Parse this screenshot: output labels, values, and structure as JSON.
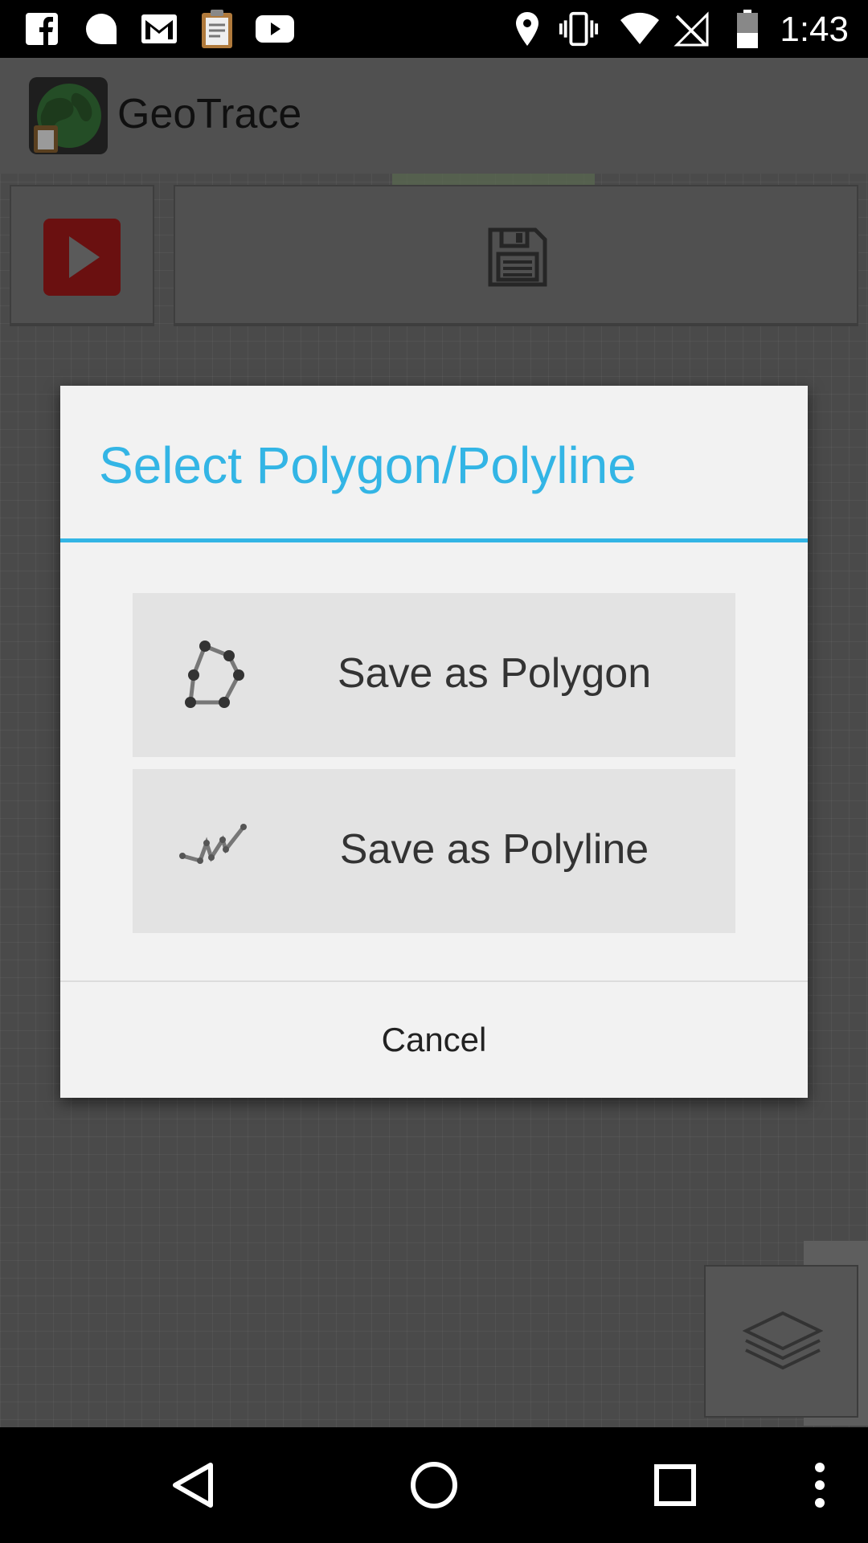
{
  "status_bar": {
    "time": "1:43",
    "icons": [
      "facebook-icon",
      "chat-bubble-icon",
      "gmail-icon",
      "clipboard-icon",
      "youtube-icon",
      "location-icon",
      "vibrate-icon",
      "wifi-icon",
      "no-signal-icon",
      "battery-icon"
    ]
  },
  "app": {
    "title": "GeoTrace"
  },
  "dialog": {
    "title": "Select Polygon/Polyline",
    "options": [
      {
        "label": "Save as Polygon",
        "icon": "polygon-icon"
      },
      {
        "label": "Save as Polyline",
        "icon": "polyline-icon"
      }
    ],
    "cancel_label": "Cancel"
  },
  "nav_bar": {
    "icons": [
      "back-icon",
      "home-icon",
      "recents-icon",
      "overflow-menu-icon"
    ]
  },
  "colors": {
    "accent": "#33b5e5",
    "dialog_bg": "#f2f2f2",
    "option_bg": "#e3e3e3"
  }
}
